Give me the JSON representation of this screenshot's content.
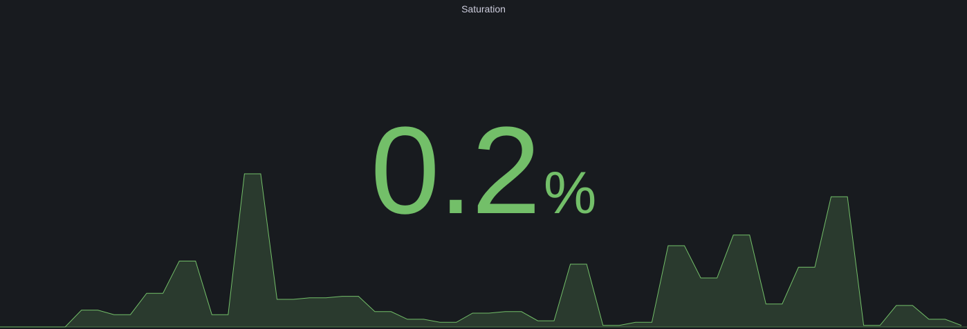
{
  "panel": {
    "title": "Saturation",
    "value": "0.2",
    "unit": "%",
    "value_color": "#73bf69",
    "background": "#181b1f"
  },
  "chart_data": {
    "type": "area",
    "title": "",
    "xlabel": "",
    "ylabel": "",
    "grid": false,
    "legend": "none",
    "line_color": "#73bf69",
    "fill_color": "#2a3a2e",
    "ylim": [
      0,
      1
    ],
    "values": [
      0.0,
      0.0,
      0.0,
      0.0,
      0.0,
      0.11,
      0.11,
      0.08,
      0.08,
      0.22,
      0.22,
      0.43,
      0.43,
      0.08,
      0.08,
      1.0,
      1.0,
      0.18,
      0.18,
      0.19,
      0.19,
      0.2,
      0.2,
      0.1,
      0.1,
      0.05,
      0.05,
      0.03,
      0.03,
      0.09,
      0.09,
      0.1,
      0.1,
      0.04,
      0.04,
      0.41,
      0.41,
      0.01,
      0.01,
      0.03,
      0.03,
      0.53,
      0.53,
      0.32,
      0.32,
      0.6,
      0.6,
      0.15,
      0.15,
      0.39,
      0.39,
      0.85,
      0.85,
      0.01,
      0.01,
      0.14,
      0.14,
      0.05,
      0.05,
      0.01
    ]
  }
}
